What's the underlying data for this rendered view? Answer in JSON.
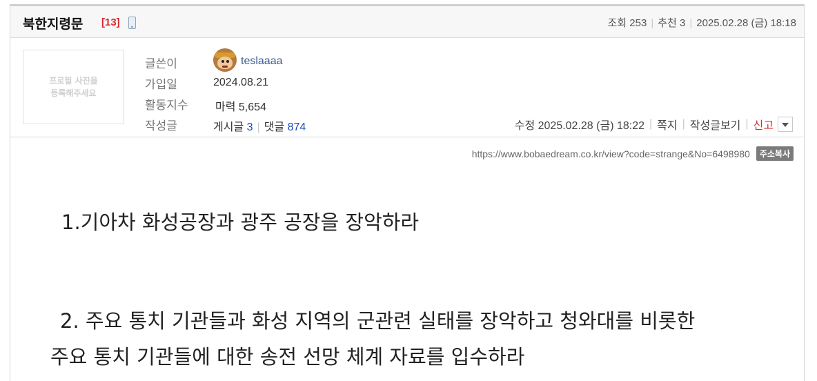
{
  "post": {
    "title": "북한지령문",
    "comment_count": "[13]",
    "views_label": "조회",
    "views": "253",
    "recommend_label": "추천",
    "recommend": "3",
    "datetime": "2025.02.28 (금) 18:18"
  },
  "profile": {
    "photo_placeholder_line1": "프로필 사진을",
    "photo_placeholder_line2": "등록해주세요",
    "author_label": "글쓴이",
    "author": "teslaaaa",
    "joined_label": "가입일",
    "joined": "2024.08.21",
    "activity_label": "활동지수",
    "activity": "마력 5,654",
    "writes_label": "작성글",
    "posts_label": "게시글",
    "posts": "3",
    "comments_label": "댓글",
    "comments": "874"
  },
  "actions": {
    "edited": "수정 2025.02.28 (금) 18:22",
    "message": "쪽지",
    "view_posts": "작성글보기",
    "report": "신고"
  },
  "link": {
    "url": "https://www.bobaedream.co.kr/view?code=strange&No=6498980",
    "copy_label": "주소복사"
  },
  "content": {
    "p1": "1.기아차 화성공장과 광주 공장을 장악하라",
    "p2_line1": " 2. 주요 통치 기관들과 화성 지역의 군관련 실태를 장악하고 청와대를 비롯한",
    "p2_line2": "주요 통치 기관들에 대한 송전 선망 체계 자료를 입수하라"
  }
}
